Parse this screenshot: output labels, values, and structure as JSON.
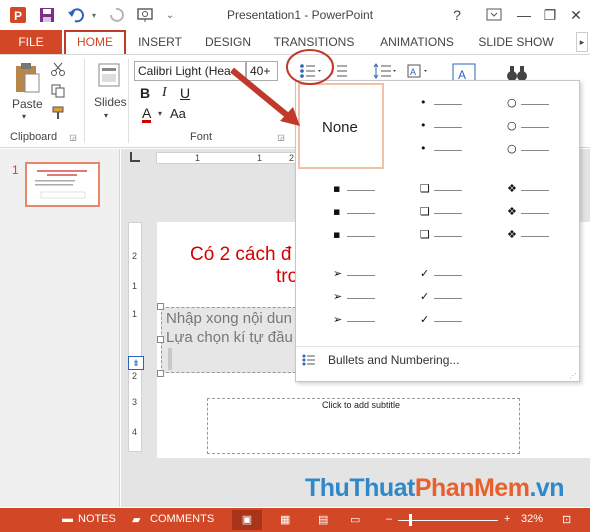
{
  "window": {
    "title": "Presentation1 - PowerPoint",
    "help": "?",
    "minimize": "—",
    "restore": "❐",
    "close": "✕"
  },
  "tabs": {
    "file": "FILE",
    "home": "HOME",
    "insert": "INSERT",
    "design": "DESIGN",
    "transitions": "TRANSITIONS",
    "animations": "ANIMATIONS",
    "slide_show": "SLIDE SHOW"
  },
  "ribbon": {
    "paste": "Paste",
    "clipboard": "Clipboard",
    "slides": "Slides",
    "font_group": "Font",
    "font_name": "Calibri Light (Hea",
    "font_size": "40+"
  },
  "slide": {
    "number": "1",
    "title_line1": "Có 2 cách đ",
    "title_line2": "tro",
    "content_line1": "Nhập xong nội dun",
    "content_line2": "Lựa chọn kí tự đầu",
    "subtitle_placeholder": "Click to add subtitle"
  },
  "bullet_gallery": {
    "none_label": "None",
    "bullets_and_numbering": "Bullets and Numbering...",
    "styles": [
      {
        "name": "filled-round",
        "char": "•"
      },
      {
        "name": "hollow-round",
        "char": "○"
      },
      {
        "name": "filled-square",
        "char": "▪"
      },
      {
        "name": "hollow-square",
        "char": "❑"
      },
      {
        "name": "star-diamond",
        "char": "❖"
      },
      {
        "name": "arrow",
        "char": "➢"
      },
      {
        "name": "check",
        "char": "✓"
      }
    ]
  },
  "statusbar": {
    "notes": "NOTES",
    "comments": "COMMENTS",
    "zoom": "32%"
  },
  "watermark": {
    "part1": "ThuThuat",
    "part2": "PhanMem",
    "part3": ".vn"
  },
  "colors": {
    "accent": "#d24726",
    "annotation": "#c0392b",
    "title_red": "#d40000"
  }
}
